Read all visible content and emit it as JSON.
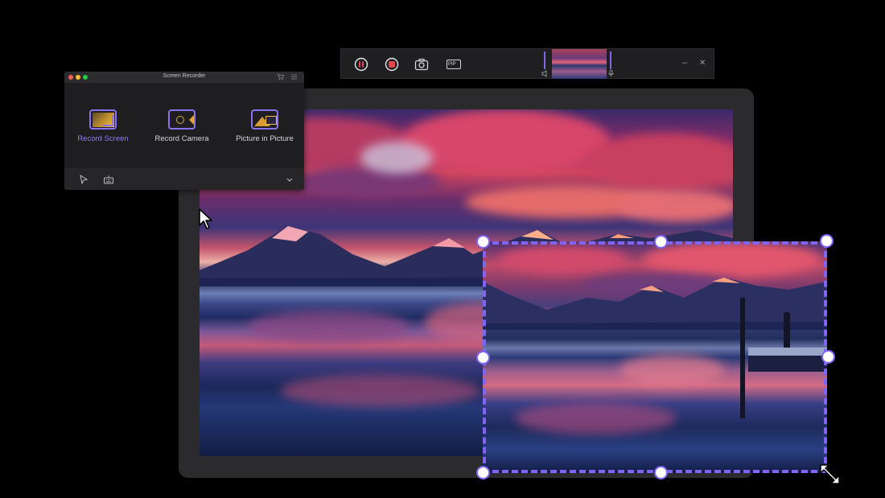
{
  "recorder": {
    "title": "Screen Recorder",
    "modes": [
      {
        "label": "Record Screen",
        "icon": "record-screen-icon",
        "active": true
      },
      {
        "label": "Record Camera",
        "icon": "record-camera-icon",
        "active": false
      },
      {
        "label": "Picture in Picture",
        "icon": "picture-in-picture-icon",
        "active": false
      }
    ],
    "footer_icons": [
      "cursor-tool-icon",
      "keyboard-icon",
      "chevron-down-icon"
    ],
    "title_icons": [
      "cart-icon",
      "menu-icon"
    ]
  },
  "toolbar": {
    "buttons": [
      "pause-icon",
      "record-stop-icon",
      "screenshot-icon",
      "pip-icon"
    ],
    "pip_label": "PIP",
    "window_controls": [
      "minimize-icon",
      "close-icon"
    ],
    "minimize_glyph": "–",
    "close_glyph": "✕"
  },
  "colors": {
    "accent": "#7f65f2",
    "record_red": "#e8434a",
    "window_bg": "#1e1e20",
    "monitor_frame": "#2b2b2d"
  }
}
